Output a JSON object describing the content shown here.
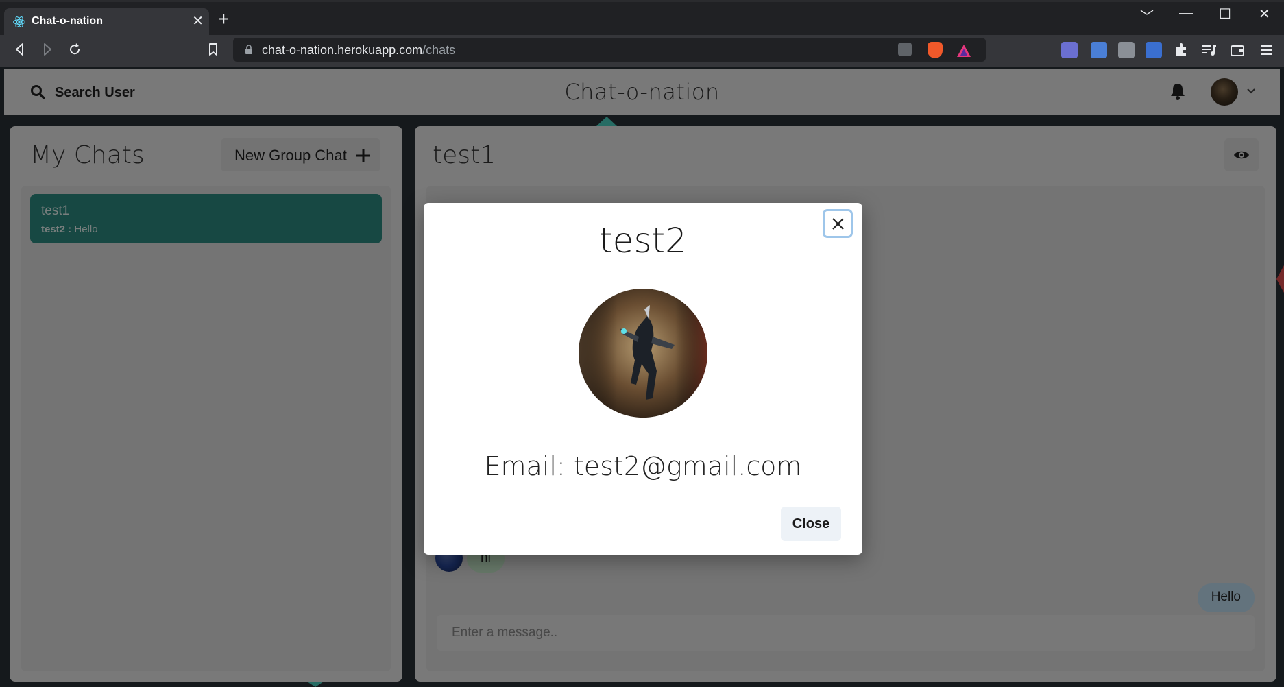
{
  "browser": {
    "tab_title": "Chat-o-nation",
    "tab_close": "✕",
    "new_tab": "+",
    "url_domain": "chat-o-nation.herokuapp.com",
    "url_path": "/chats",
    "window_controls": [
      "﹀",
      "—",
      "☐",
      "✕"
    ]
  },
  "header": {
    "search_label": "Search User",
    "brand": "Chat-o-nation"
  },
  "sidebar": {
    "title": "My Chats",
    "new_group_label": "New Group Chat",
    "chats": [
      {
        "name": "test1",
        "last_sender": "test2 :",
        "last_message": "Hello"
      }
    ]
  },
  "chat": {
    "title": "test1",
    "messages": [
      {
        "text": "hi",
        "side": "left"
      },
      {
        "text": "Hello",
        "side": "right"
      }
    ],
    "input_placeholder": "Enter a message.."
  },
  "modal": {
    "title": "test2",
    "email_text": "Email: test2@gmail.com",
    "close_label": "Close"
  },
  "colors": {
    "accent_teal": "#2c8a80",
    "bubble_left": "#c5e8c9",
    "bubble_right": "#bfdcf0"
  }
}
